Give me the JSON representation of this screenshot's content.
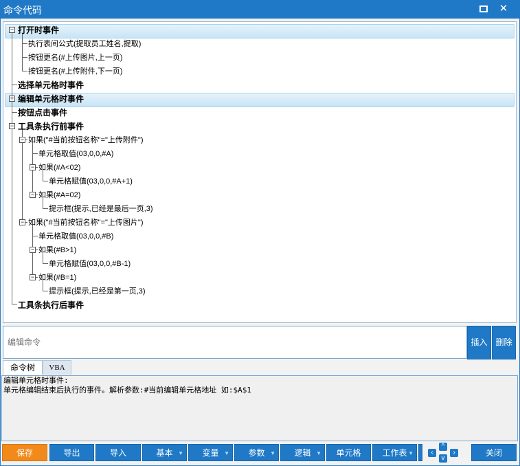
{
  "window": {
    "title": "命令代码",
    "restore_icon": "restore-icon",
    "close_icon": "close-icon"
  },
  "tree": {
    "roots": [
      {
        "label": "打开时事件",
        "expanded": true,
        "highlighted": true
      },
      {
        "label": "选择单元格时事件"
      },
      {
        "label": "编辑单元格时事件",
        "highlighted": true
      },
      {
        "label": "按钮点击事件"
      },
      {
        "label": "工具条执行前事件",
        "expanded": true
      },
      {
        "label": "工具条执行后事件"
      }
    ],
    "open_children": [
      "执行表间公式(提取员工姓名,提取)",
      "按钮更名(#上传图片,上一页)",
      "按钮更名(#上传附件,下一页)"
    ],
    "toolbar_children": {
      "if1": "如果(\"#当前按钮名称\"=\"上传附件\")",
      "if1_a": "单元格取值(03,0,0,#A)",
      "if1_b": "如果(#A<02)",
      "if1_b1": "单元格赋值(03,0,0,#A+1)",
      "if1_c": "如果(#A=02)",
      "if1_c1": "提示框(提示,已经是最后一页,3)",
      "if2": "如果(\"#当前按钮名称\"=\"上传图片\")",
      "if2_a": "单元格取值(03,0,0,#B)",
      "if2_b": "如果(#B>1)",
      "if2_b1": "单元格赋值(03,0,0,#B-1)",
      "if2_c": "如果(#B=1)",
      "if2_c1": "提示框(提示,已经是第一页,3)"
    }
  },
  "command": {
    "placeholder": "编辑命令",
    "insert_label": "插入",
    "delete_label": "删除"
  },
  "tabs": [
    {
      "label": "命令树",
      "active": true
    },
    {
      "label": "VBA",
      "active": false
    }
  ],
  "description": {
    "line1": "编辑单元格时事件:",
    "line2": "单元格编辑结束后执行的事件。解析参数:#当前编辑单元格地址 如:$A$1"
  },
  "buttons": {
    "save": "保存",
    "export": "导出",
    "import": "导入",
    "basic": "基本",
    "variable": "变量",
    "param": "参数",
    "logic": "逻辑",
    "cell": "单元格",
    "sheet": "工作表",
    "close": "关闭"
  },
  "colors": {
    "accent": "#1f79c7",
    "save": "#f28a1b",
    "highlight": "#c7e4f5"
  }
}
